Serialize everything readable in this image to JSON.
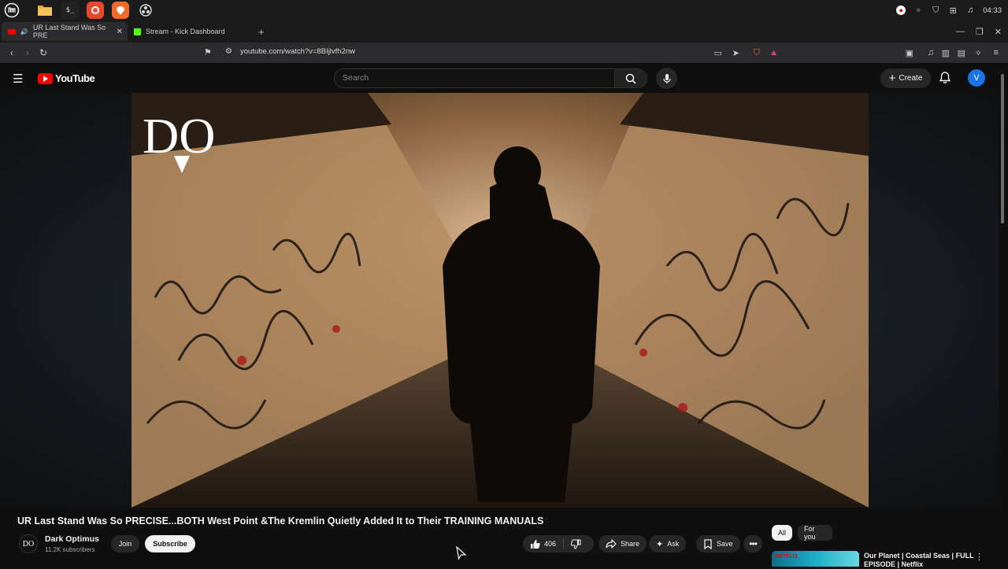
{
  "os": {
    "time": "04:33",
    "apps": [
      "mint-menu-icon",
      "files-icon",
      "terminal-icon",
      "firefox-icon",
      "brave-icon",
      "obs-icon"
    ]
  },
  "browser": {
    "tabs": [
      {
        "label": "UR Last Stand Was So PRE",
        "active": true
      },
      {
        "label": "Stream - Kick Dashboard",
        "active": false
      }
    ],
    "url": "youtube.com/watch?v=8BIjlvfh2nw"
  },
  "youtube": {
    "logo": "YouTube",
    "search_placeholder": "Search",
    "create_label": "Create",
    "avatar_letter": "V"
  },
  "video": {
    "overlay_logo": "DO",
    "title": "UR Last Stand Was So PRECISE...BOTH West Point &The Kremlin Quietly Added It to Their TRAINING MANUALS"
  },
  "channel": {
    "avatar_text": "DO",
    "name": "Dark Optimus",
    "subscribers": "11.2K subscribers",
    "join_label": "Join",
    "subscribe_label": "Subscribe"
  },
  "actions": {
    "likes": "406",
    "share_label": "Share",
    "ask_label": "Ask",
    "save_label": "Save"
  },
  "sidebar": {
    "chips": [
      "All",
      "For you"
    ],
    "recommendation": {
      "title": "Our Planet | Coastal Seas | FULL EPISODE | Netflix",
      "badge": "NETFLIX"
    }
  }
}
